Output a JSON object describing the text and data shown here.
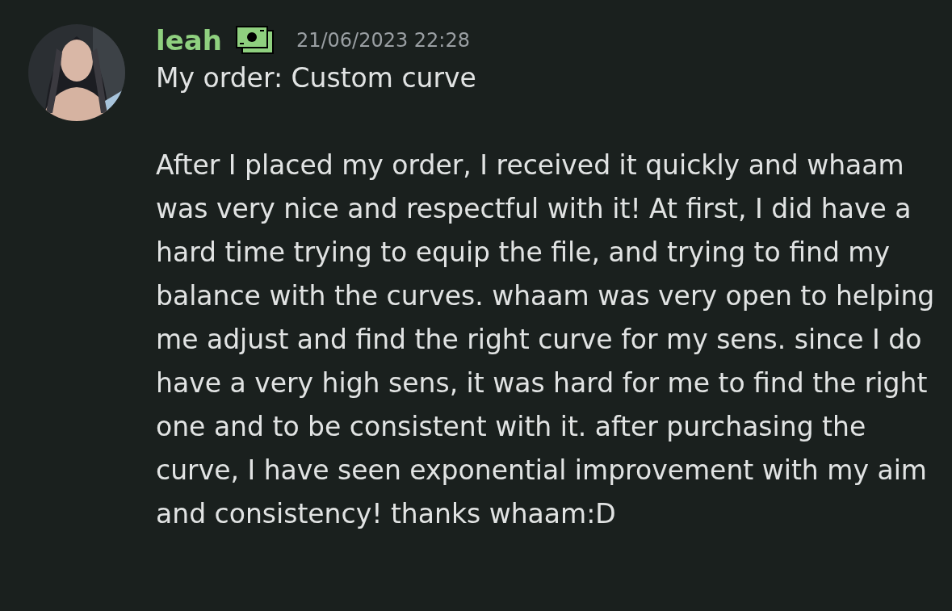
{
  "message": {
    "author": "leah",
    "timestamp": "21/06/2023 22:28",
    "paragraphs": [
      "My order: Custom curve",
      "After I placed my order, I received it quickly and whaam was very nice and respectful with it! At first, I did have a hard time trying to equip the file, and trying to find my  balance with the curves. whaam was very open to helping me adjust and find the right curve for my sens. since I do have a very high sens, it was hard for me to find the right one and to be consistent with it. after purchasing the curve, I have seen exponential improvement with my aim and consistency! thanks whaam:D"
    ]
  }
}
